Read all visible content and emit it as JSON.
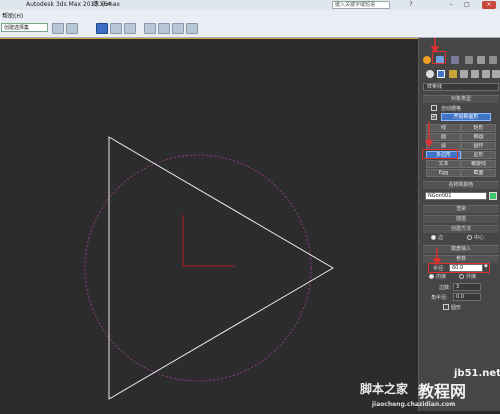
{
  "titlebar": {
    "app_title": "Autodesk 3ds Max  2013 x64",
    "file_name": "练习.max",
    "help_search_placeholder": "键入关键字或短语"
  },
  "menubar": {
    "help_label": "帮助(H)"
  },
  "toolbar": {
    "selection_set": "创建选择集"
  },
  "panel": {
    "category_dropdown": "样条线",
    "object_type": {
      "title": "对象类型",
      "autogrid_label": "自动栅格",
      "start_new_shape": "开始新图形",
      "buttons": [
        "线",
        "矩形",
        "圆",
        "椭圆",
        "弧",
        "圆环",
        "多边形",
        "星形",
        "文本",
        "螺旋线",
        "Egg",
        "截面"
      ]
    },
    "name_color": {
      "title": "名称和颜色",
      "object_name": "NGon001"
    },
    "rollouts": [
      "渲染",
      "插值",
      "创建方法"
    ],
    "creation_method": {
      "edge": "边",
      "center": "中心"
    },
    "keyboard_entry": "键盘输入",
    "parameters": {
      "title": "参数",
      "radius_label": "半径:",
      "radius_value": "60.0",
      "inscribed": "内接",
      "circumscribed": "外接",
      "sides_label": "边数:",
      "sides_value": "3",
      "corner_radius_label": "角半径:",
      "corner_radius_value": "0.0",
      "circular_label": "圆形"
    }
  },
  "watermark": {
    "site": "jb51.net",
    "cn": "教程网",
    "prefix": "脚本之家",
    "url": "jiaocheng.chazidian.com"
  },
  "colors": {
    "highlight": "#e03030",
    "active_button": "#3f74c6",
    "viewport_border": "#c9a53a"
  }
}
